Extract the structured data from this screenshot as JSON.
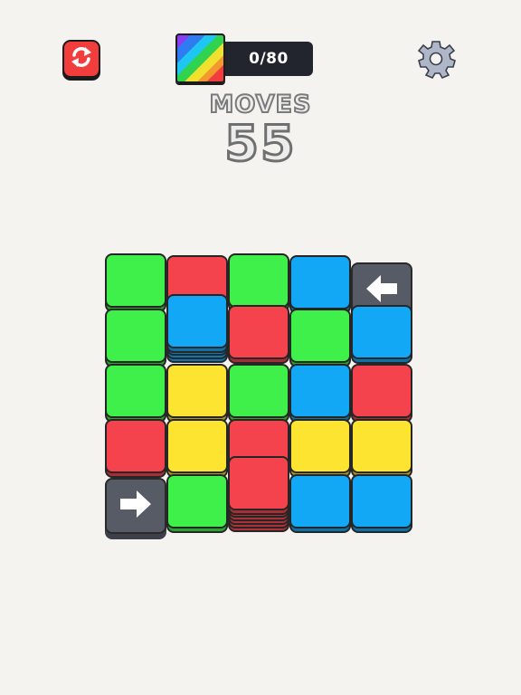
{
  "header": {
    "progress_text": "0/80",
    "moves_label": "MOVES",
    "moves_value": "55"
  },
  "icons": {
    "restart": "refresh-icon",
    "settings": "gear-icon",
    "rainbow": "rainbow-badge-icon",
    "arrow_left": "arrow-left-icon",
    "arrow_right": "arrow-right-icon"
  },
  "colors": {
    "green": "#3ff04a",
    "red": "#f5434d",
    "blue": "#12a8f5",
    "yellow": "#fde431",
    "arrow_tile": "#575b66",
    "background": "#f5f3ef",
    "restart_button": "#f23d3d",
    "progress_bar": "#23252e"
  },
  "board": {
    "rows": [
      [
        "green",
        "red",
        "green",
        "blue",
        "arrow-left"
      ],
      [
        "green",
        "blue",
        "red",
        "green",
        "blue"
      ],
      [
        "green",
        "yellow",
        "green",
        "blue",
        "red"
      ],
      [
        "red",
        "yellow",
        "red",
        "yellow",
        "yellow"
      ],
      [
        "arrow-right",
        "green",
        "red",
        "blue",
        "blue"
      ]
    ],
    "stack_depths": [
      [
        1,
        2,
        1,
        1,
        1
      ],
      [
        1,
        5,
        2,
        1,
        2
      ],
      [
        1,
        2,
        1,
        2,
        1
      ],
      [
        1,
        2,
        2,
        2,
        1
      ],
      [
        1,
        2,
        7,
        2,
        2
      ]
    ]
  }
}
